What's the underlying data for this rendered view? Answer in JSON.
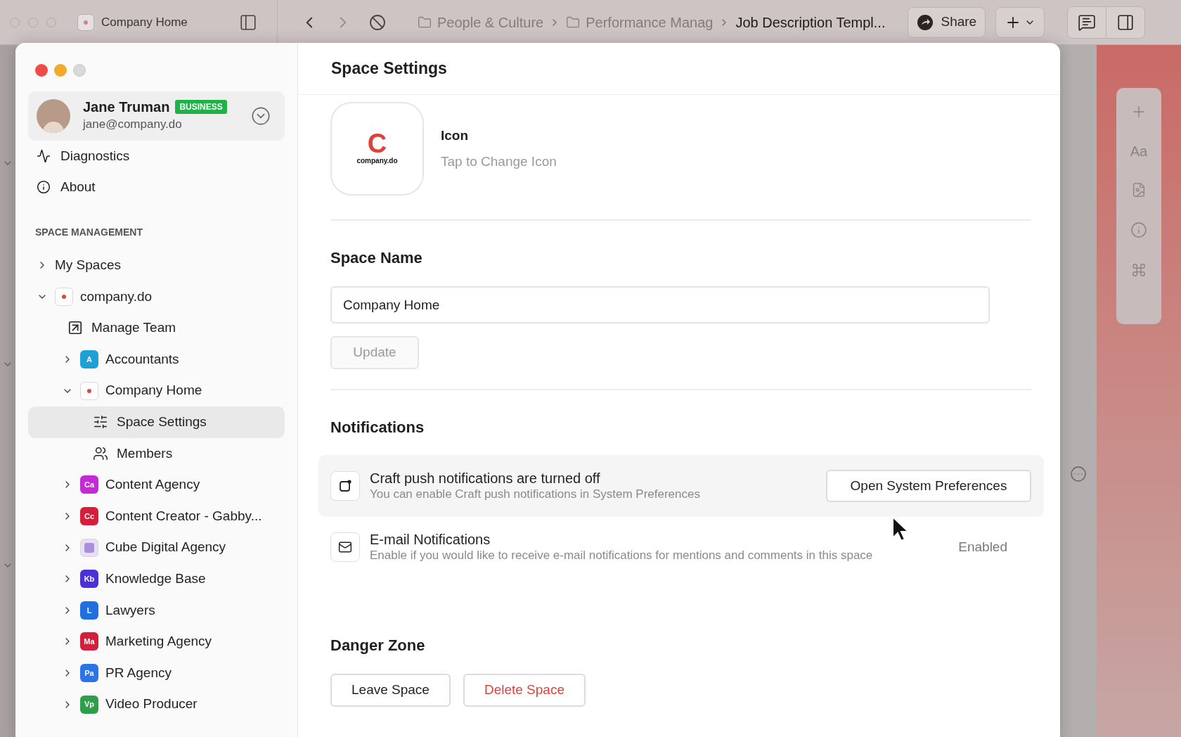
{
  "app_toolbar": {
    "space_title": "Company Home",
    "breadcrumbs": [
      {
        "label": "People & Culture",
        "kind": "folder"
      },
      {
        "label": "Performance Manag",
        "kind": "folder"
      },
      {
        "label": "Job Description Templ...",
        "kind": "page"
      }
    ],
    "share_button": "Share"
  },
  "side_toolbar": {
    "text_style_label": "Aa"
  },
  "settings_window": {
    "sidebar": {
      "account": {
        "name": "Jane Truman",
        "plan_badge": "BUSINESS",
        "email": "jane@company.do"
      },
      "menu_items": [
        {
          "kind": "diagnostics",
          "label": "Diagnostics"
        },
        {
          "kind": "about",
          "label": "About"
        }
      ],
      "section_title": "SPACE MANAGEMENT",
      "tree": [
        {
          "label": "My Spaces",
          "kind": "plain",
          "expanded": false,
          "selected": false
        },
        {
          "label": "company.do",
          "kind": "logo",
          "expanded": true,
          "selected": false,
          "children": [
            {
              "label": "Manage Team",
              "kind": "link",
              "selected": false
            },
            {
              "label": "Accountants",
              "kind": "badge",
              "badge": "A",
              "color": "#1e9fd6",
              "expanded": false,
              "selected": false
            },
            {
              "label": "Company Home",
              "kind": "logo",
              "expanded": true,
              "selected": false,
              "children": [
                {
                  "label": "Space Settings",
                  "kind": "settings",
                  "selected": true
                },
                {
                  "label": "Members",
                  "kind": "members",
                  "selected": false
                }
              ]
            },
            {
              "label": "Content Agency",
              "kind": "badge",
              "badge": "Ca",
              "color": "#c22ad6",
              "expanded": false,
              "selected": false
            },
            {
              "label": "Content Creator - Gabby...",
              "kind": "badge",
              "badge": "Cc",
              "color": "#d41f3a",
              "expanded": false,
              "selected": false
            },
            {
              "label": "Cube Digital Agency",
              "kind": "picture",
              "expanded": false,
              "selected": false
            },
            {
              "label": "Knowledge Base",
              "kind": "badge",
              "badge": "Kb",
              "color": "#4a33d6",
              "expanded": false,
              "selected": false
            },
            {
              "label": "Lawyers",
              "kind": "badge",
              "badge": "L",
              "color": "#1f6fe0",
              "expanded": false,
              "selected": false
            },
            {
              "label": "Marketing Agency",
              "kind": "badge",
              "badge": "Ma",
              "color": "#d41f3a",
              "expanded": false,
              "selected": false
            },
            {
              "label": "PR Agency",
              "kind": "badge",
              "badge": "Pa",
              "color": "#2a74e8",
              "expanded": false,
              "selected": false
            },
            {
              "label": "Video Producer",
              "kind": "badge",
              "badge": "Vp",
              "color": "#2f9e48",
              "expanded": false,
              "selected": false
            }
          ]
        }
      ]
    },
    "main": {
      "title": "Space Settings",
      "icon_section": {
        "logo_letter": "C",
        "logo_wordmark": "company.do",
        "label": "Icon",
        "hint": "Tap to Change Icon"
      },
      "name_section": {
        "heading": "Space Name",
        "value": "Company Home",
        "update_button": {
          "label": "Update",
          "disabled": true
        }
      },
      "notifications": {
        "heading": "Notifications",
        "items": [
          {
            "kind": "push",
            "title": "Craft push notifications are turned off",
            "description": "You can enable Craft push notifications in System Preferences",
            "button": "Open System Preferences"
          },
          {
            "kind": "email",
            "title": "E-mail Notifications",
            "description": "Enable if you would like to receive e-mail notifications for mentions and comments in this space",
            "status": "Enabled"
          }
        ]
      },
      "danger_zone": {
        "heading": "Danger Zone",
        "buttons": [
          {
            "label": "Leave Space",
            "kind": "normal"
          },
          {
            "label": "Delete Space",
            "kind": "danger"
          }
        ]
      }
    }
  }
}
